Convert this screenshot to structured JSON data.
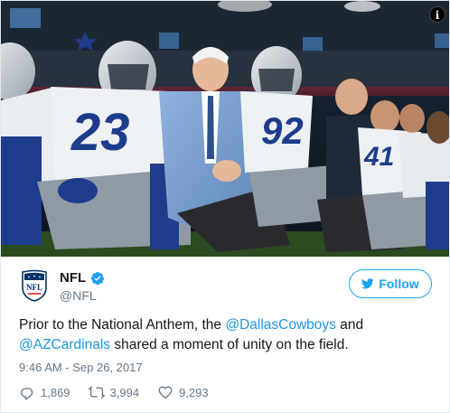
{
  "photo": {
    "info_glyph": "i",
    "jersey_numbers": [
      "23",
      "92",
      "41"
    ]
  },
  "account": {
    "name": "NFL",
    "handle": "@NFL",
    "avatar_text": "NFL",
    "avatar_icon": "nfl-shield-logo",
    "verified_icon": "verified-badge-icon"
  },
  "follow_button": {
    "label": "Follow",
    "icon": "twitter-bird-icon"
  },
  "tweet": {
    "text_part1": "Prior to the National Anthem, the ",
    "mention1": "@DallasCowboys",
    "text_part2": " and ",
    "mention2": "@AZCardinals",
    "text_part3": " shared a moment of unity on the field.",
    "timestamp": "9:46 AM - Sep 26, 2017"
  },
  "actions": {
    "replies": "1,869",
    "retweets": "3,994",
    "likes": "9,293"
  },
  "colors": {
    "accent": "#1da1f2",
    "mention": "#1b95e0",
    "secondary_text": "#657786",
    "primary_text": "#14171a"
  }
}
